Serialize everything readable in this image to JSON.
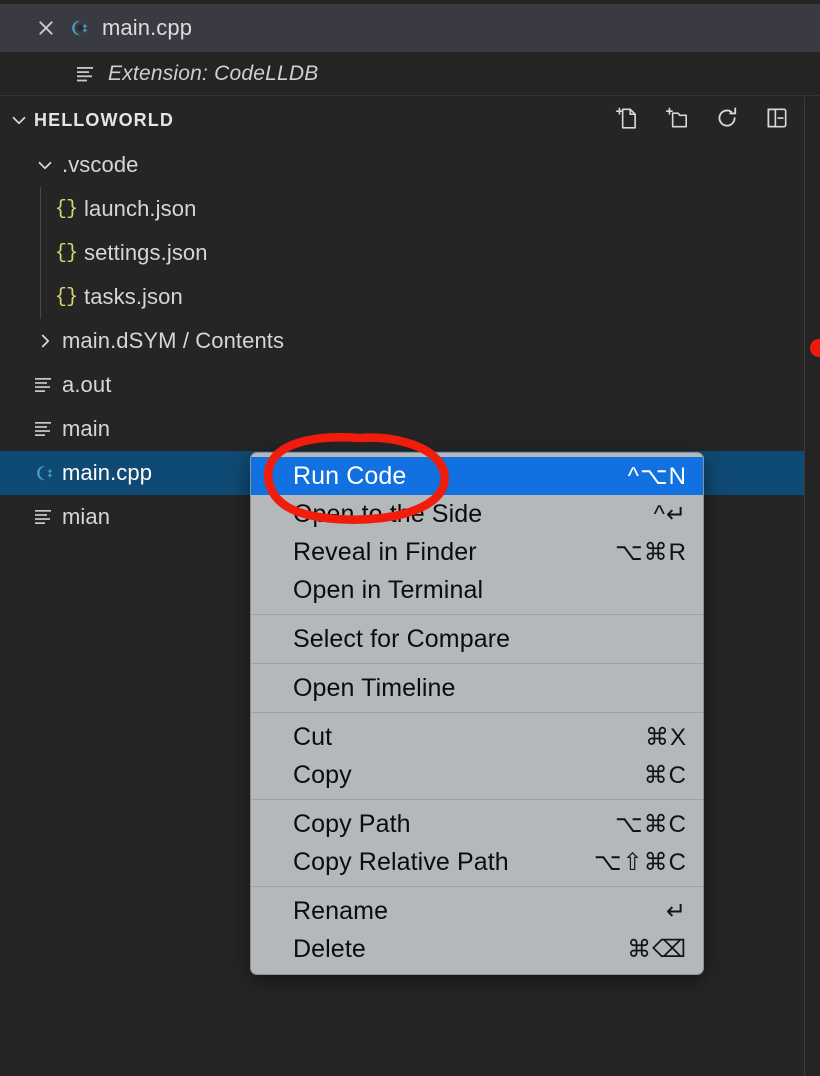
{
  "tab": {
    "label": "main.cpp",
    "close_icon": "close-icon",
    "file_icon": "cpp-file-icon"
  },
  "breadcrumb": {
    "icon": "outline-lines-icon",
    "text": "Extension: CodeLLDB"
  },
  "sidebar": {
    "title": "HELLOWORLD",
    "expand_icon": "chevron-down-icon",
    "actions": [
      {
        "name": "new-file-button",
        "icon": "new-file-icon"
      },
      {
        "name": "new-folder-button",
        "icon": "new-folder-icon"
      },
      {
        "name": "refresh-button",
        "icon": "refresh-icon"
      },
      {
        "name": "collapse-all-button",
        "icon": "collapse-all-icon"
      }
    ],
    "tree": [
      {
        "label": ".vscode",
        "icon": "chevron-down-icon",
        "kind": "folder-open",
        "indent": 0,
        "selected": false
      },
      {
        "label": "launch.json",
        "icon": "json-icon",
        "kind": "json",
        "indent": 1,
        "selected": false
      },
      {
        "label": "settings.json",
        "icon": "json-icon",
        "kind": "json",
        "indent": 1,
        "selected": false
      },
      {
        "label": "tasks.json",
        "icon": "json-icon",
        "kind": "json",
        "indent": 1,
        "selected": false
      },
      {
        "label": "main.dSYM / Contents",
        "icon": "chevron-right-icon",
        "kind": "folder-closed",
        "indent": 0,
        "selected": false
      },
      {
        "label": "a.out",
        "icon": "file-lines-icon",
        "kind": "file",
        "indent": 0,
        "selected": false
      },
      {
        "label": "main",
        "icon": "file-lines-icon",
        "kind": "file",
        "indent": 0,
        "selected": false
      },
      {
        "label": "main.cpp",
        "icon": "cpp-file-icon",
        "kind": "cpp",
        "indent": 0,
        "selected": true
      },
      {
        "label": "mian",
        "icon": "file-lines-icon",
        "kind": "file",
        "indent": 0,
        "selected": false
      }
    ]
  },
  "context_menu": {
    "groups": [
      [
        {
          "label": "Run Code",
          "shortcut": "^⌥N",
          "highlighted": true
        },
        {
          "label": "Open to the Side",
          "shortcut": "^↵",
          "highlighted": false
        },
        {
          "label": "Reveal in Finder",
          "shortcut": "⌥⌘R",
          "highlighted": false
        },
        {
          "label": "Open in Terminal",
          "shortcut": "",
          "highlighted": false
        }
      ],
      [
        {
          "label": "Select for Compare",
          "shortcut": "",
          "highlighted": false
        }
      ],
      [
        {
          "label": "Open Timeline",
          "shortcut": "",
          "highlighted": false
        }
      ],
      [
        {
          "label": "Cut",
          "shortcut": "⌘X",
          "highlighted": false
        },
        {
          "label": "Copy",
          "shortcut": "⌘C",
          "highlighted": false
        }
      ],
      [
        {
          "label": "Copy Path",
          "shortcut": "⌥⌘C",
          "highlighted": false
        },
        {
          "label": "Copy Relative Path",
          "shortcut": "⌥⇧⌘C",
          "highlighted": false
        }
      ],
      [
        {
          "label": "Rename",
          "shortcut": "↵",
          "highlighted": false
        },
        {
          "label": "Delete",
          "shortcut": "⌘⌫",
          "highlighted": false
        }
      ]
    ]
  },
  "annotation": {
    "shape": "hand-drawn-ellipse",
    "color": "#f01d0c",
    "target": "Run Code"
  },
  "colors": {
    "selection_blue": "#0f4a74",
    "menu_highlight_blue": "#1271e0",
    "menu_background": "#b4b8bb",
    "sidebar_background": "#252526",
    "tabbar_background": "#3a3a42",
    "json_icon_yellow": "#d7d76a",
    "cpp_icon_blue": "#4aa3c7",
    "annotation_red": "#f01d0c"
  }
}
